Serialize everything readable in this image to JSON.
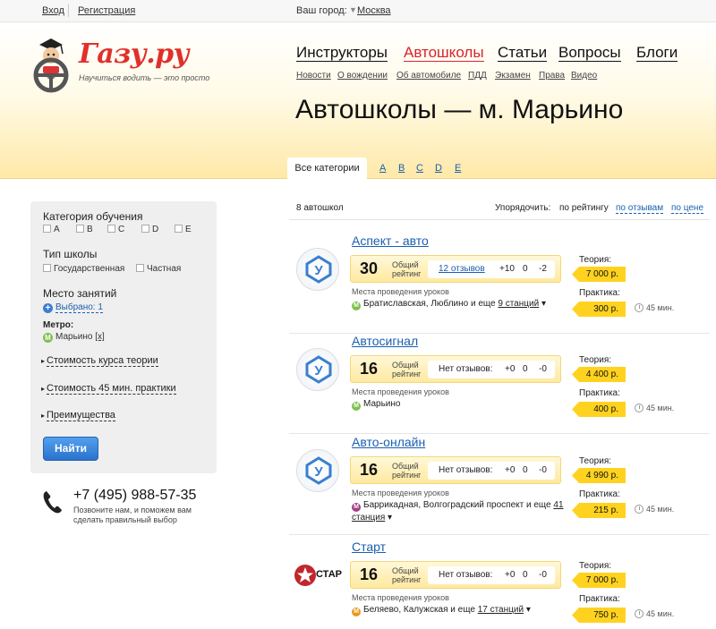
{
  "topbar": {
    "login": "Вход",
    "register": "Регистрация",
    "city_label": "Ваш город:",
    "city": "Москва"
  },
  "logo": {
    "text": "Газу.ру",
    "tagline": "Научиться водить — это просто"
  },
  "main_nav": [
    "Инструкторы",
    "Автошколы",
    "Статьи",
    "Вопросы",
    "Блоги"
  ],
  "sub_nav": [
    "Новости",
    "О вождении",
    "Об автомобиле",
    "ПДД",
    "Экзамен",
    "Права",
    "Видео"
  ],
  "page_title": "Автошколы — м. Марьино",
  "category_tabs": {
    "active": "Все категории",
    "letters": [
      "A",
      "B",
      "C",
      "D",
      "E"
    ]
  },
  "filter": {
    "category_label": "Категория обучения",
    "categories": [
      "A",
      "B",
      "C",
      "D",
      "E"
    ],
    "school_type_label": "Тип школы",
    "school_types": [
      "Государственная",
      "Частная"
    ],
    "place_label": "Место занятий",
    "selected": "Выбрано: 1",
    "metro_label": "Метро:",
    "metro_value": "Марьино",
    "metro_remove": "[x]",
    "theory_cost": "Стоимость курса теории",
    "practice_cost": "Стоимость 45 мин. практики",
    "advantages": "Преимущества",
    "find_button": "Найти"
  },
  "contact": {
    "phone": "+7 (495) 988-57-35",
    "note": "Позвоните нам, и поможем вам сделать правильный выбор"
  },
  "results": {
    "count": "8 автошкол",
    "sort_label": "Упорядочить:",
    "sort_options": [
      "по рейтингу",
      "по отзывам",
      "по цене"
    ]
  },
  "common": {
    "rating_label_1": "Общий",
    "rating_label_2": "рейтинг",
    "places_label": "Места проведения уроков",
    "theory_label": "Теория:",
    "practice_label": "Практика:",
    "duration": "45 мин."
  },
  "schools": [
    {
      "name": "Аспект - авто",
      "rating": "30",
      "reviews": "12 отзывов",
      "pos": "+10",
      "neu": "0",
      "neg": "-2",
      "stations_text": "Братиславская, Люблино и еще ",
      "stations_more": "9 станций",
      "theory_price": "7 000 р.",
      "practice_price": "300 р."
    },
    {
      "name": "Автосигнал",
      "rating": "16",
      "reviews": "Нет отзывов:",
      "pos": "+0",
      "neu": "0",
      "neg": "-0",
      "stations_text": "Марьино",
      "stations_more": "",
      "theory_price": "4 400 р.",
      "practice_price": "400 р."
    },
    {
      "name": "Авто-онлайн",
      "rating": "16",
      "reviews": "Нет отзывов:",
      "pos": "+0",
      "neu": "0",
      "neg": "-0",
      "stations_text": "Баррикадная, Волгоградский проспект и еще ",
      "stations_more": "41 станция",
      "theory_price": "4 990 р.",
      "practice_price": "215 р."
    },
    {
      "name": "Старт",
      "rating": "16",
      "reviews": "Нет отзывов:",
      "pos": "+0",
      "neu": "0",
      "neg": "-0",
      "stations_text": "Беляево, Калужская и еще ",
      "stations_more": "17 станций",
      "theory_price": "7 000 р.",
      "practice_price": "750 р.",
      "logo_text": "СТАР"
    }
  ],
  "colors": {
    "brand_red": "#e0302a",
    "link_blue": "#1a5fb0",
    "price_yellow": "#ffd21f"
  }
}
